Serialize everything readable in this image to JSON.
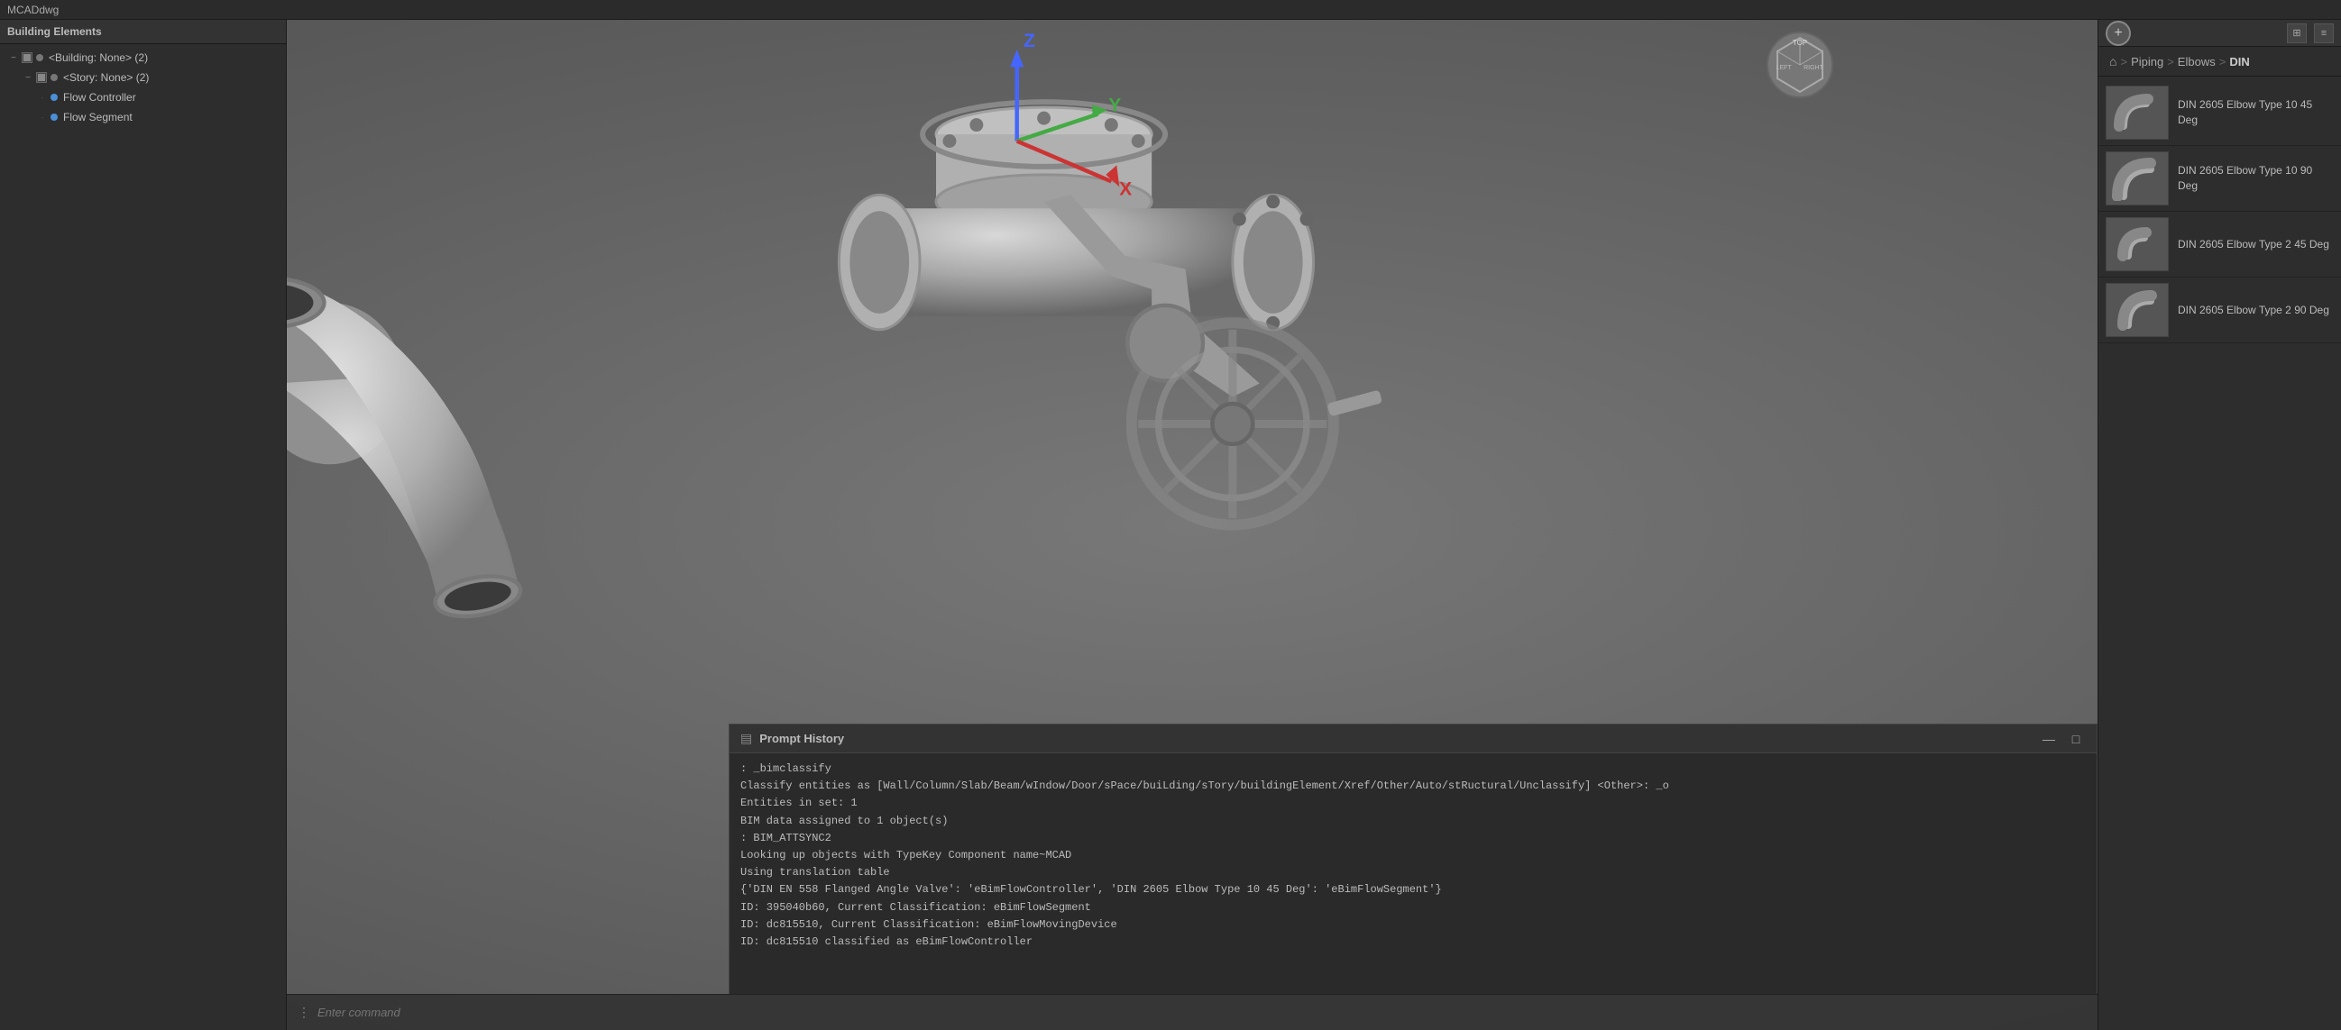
{
  "app": {
    "title": "MCADdwg"
  },
  "sidebar": {
    "header": "Building Elements",
    "tree": [
      {
        "id": "building-none",
        "label": "<Building: None> (2)",
        "indent": 1,
        "hasExpand": true,
        "expandState": "minus",
        "hasDot": true,
        "dotColor": "gray"
      },
      {
        "id": "story-none",
        "label": "<Story: None> (2)",
        "indent": 2,
        "hasExpand": true,
        "expandState": "minus",
        "hasDot": true,
        "dotColor": "gray"
      },
      {
        "id": "flow-controller",
        "label": "Flow Controller",
        "indent": 3,
        "hasExpand": false,
        "hasDot": true,
        "dotColor": "blue"
      },
      {
        "id": "flow-segment",
        "label": "Flow Segment",
        "indent": 3,
        "hasExpand": false,
        "hasDot": true,
        "dotColor": "blue"
      }
    ]
  },
  "breadcrumb": {
    "home_icon": "⌂",
    "items": [
      "Piping",
      "Elbows",
      "DIN"
    ]
  },
  "library": {
    "items": [
      {
        "id": "lib-1",
        "label": "DIN 2605 Elbow Type 10 45 Deg"
      },
      {
        "id": "lib-2",
        "label": "DIN 2605 Elbow Type 10 90 Deg"
      },
      {
        "id": "lib-3",
        "label": "DIN 2605 Elbow Type 2 45 Deg"
      },
      {
        "id": "lib-4",
        "label": "DIN 2605 Elbow Type 2 90 Deg"
      }
    ]
  },
  "prompt_history": {
    "title": "Prompt History",
    "lines": [
      ": _bimclassify",
      "Classify entities as [Wall/Column/Slab/Beam/wIndow/Door/sPace/buiLding/sTory/buildingElement/Xref/Other/Auto/stRuctural/Unclassify] <Other>: _o",
      "Entities in set: 1",
      "BIM data assigned to 1 object(s)",
      ": BIM_ATTSYNC2",
      "Looking up objects with TypeKey Component name~MCAD",
      "Using translation table",
      "{'DIN EN 558 Flanged Angle Valve': 'eBimFlowController', 'DIN 2605 Elbow Type 10 45 Deg': 'eBimFlowSegment'}",
      "ID: 395040b60, Current Classification: eBimFlowSegment",
      "ID: dc815510, Current Classification: eBimFlowMovingDevice",
      "ID: dc815510 classified as eBimFlowController"
    ]
  },
  "command": {
    "placeholder": "Enter command"
  },
  "panel_buttons": {
    "add": "+",
    "grid_icon": "⊞",
    "list_icon": "≡",
    "minimize": "—",
    "maximize": "□"
  }
}
